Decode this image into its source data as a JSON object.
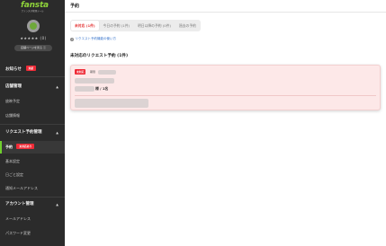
{
  "brand": {
    "logo_text": "fansta",
    "logo_sub": "ファンスタ管理ツール"
  },
  "profile": {
    "rating_text": "★★★★★ (0)",
    "detail_button_label": "店舗ページを見る ⓘ"
  },
  "sidebar": {
    "notice_label": "お知らせ",
    "notice_badge": "未読",
    "store_section_label": "店舗管理",
    "store_items": [
      "放映予定",
      "店舗情報"
    ],
    "request_section_label": "リクエスト予約管理",
    "request_items": [
      {
        "label": "予約",
        "badge": "未対応あり"
      },
      {
        "label": "基本設定"
      },
      {
        "label": "日ごと設定"
      },
      {
        "label": "通知メールアドレス"
      }
    ],
    "account_section_label": "アカウント管理",
    "account_items": [
      "メールアドレス",
      "パスワード変更"
    ]
  },
  "header": {
    "page_title": "予約"
  },
  "tabs": [
    {
      "label": "未対応 (1件)"
    },
    {
      "label": "今日の予約 (1件)"
    },
    {
      "label": "明日以降の予約 (0件)"
    },
    {
      "label": "過去の予約"
    }
  ],
  "help_link": "リクエスト予約機能の使い方",
  "section_title": "未対応のリクエスト予約 (1件)",
  "card": {
    "badge": "未対応",
    "label": "期限",
    "count_text": "様 / 1名"
  },
  "colors": {
    "accent_red": "#ef2b37",
    "brand_green": "#8fd43a",
    "sidebar_bg": "#2b2b2b",
    "card_bg": "#fde8e8"
  }
}
